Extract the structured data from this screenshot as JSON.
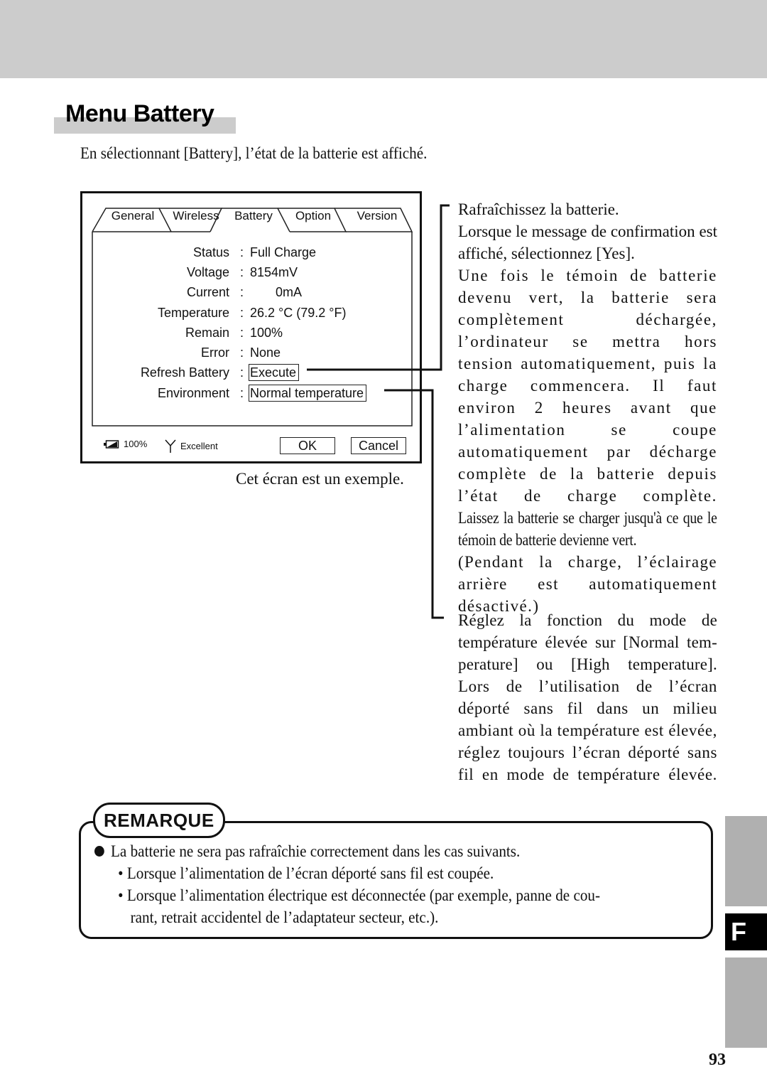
{
  "section": {
    "title": "Menu Battery",
    "intro": "En sélectionnant [Battery], l’état de la batterie est affiché."
  },
  "dialog": {
    "tabs": [
      {
        "label": "General",
        "active": false
      },
      {
        "label": "Wireless",
        "active": false
      },
      {
        "label": "Battery",
        "active": true
      },
      {
        "label": "Option",
        "active": false
      },
      {
        "label": "Version",
        "active": false
      }
    ],
    "rows": [
      {
        "label": "Status",
        "value": "Full Charge"
      },
      {
        "label": "Voltage",
        "value": "8154mV"
      },
      {
        "label": "Current",
        "value": "0mA"
      },
      {
        "label": "Temperature",
        "value": "26.2 °C (79.2 °F)"
      },
      {
        "label": "Remain",
        "value": "100%"
      },
      {
        "label": "Error",
        "value": "None"
      },
      {
        "label": "Refresh Battery",
        "value": "Execute"
      },
      {
        "label": "Environment",
        "value": "Normal temperature"
      }
    ],
    "separator": ":",
    "status_bar": {
      "battery_icon": "battery-icon",
      "battery_level": "100%",
      "signal_icon": "antenna-icon",
      "signal_quality": "Excellent"
    },
    "buttons": {
      "ok": "OK",
      "cancel": "Cancel"
    }
  },
  "caption": "Cet écran est un exemple.",
  "refresh_description": {
    "lines": [
      "Rafraîchissez la batterie.",
      "Lorsque le message de confirmation est affiché, sélectionnez [Yes].",
      "Une fois le témoin de batterie devenu vert, la batterie sera complètement déchargée, l’ordinateur se mettra hors tension automatiquement, puis la charge commencera. Il faut environ 2 heures avant que l’alimentation se coupe automatiquement par décharge complète de la batterie depuis l’état de charge complète.",
      "Laissez la batterie se charger jusqu'à ce que le témoin de batterie devienne vert.",
      "(Pendant la charge, l’éclairage arrière est automatiquement désactivé.)"
    ]
  },
  "environment_description": {
    "lines": [
      "Réglez la fonction du mode de température élevée sur [Normal tem-perature] ou [High temperature].",
      "Lors de l’utilisation de l’écran déporté sans fil dans un milieu ambiant où la température est élevée, réglez toujours l’écran déporté sans fil en mode de température élevée."
    ]
  },
  "remarque": {
    "title": "REMARQUE",
    "main": "La batterie ne sera pas rafraîchie correctement dans les cas suivants.",
    "items": [
      "Lorsque l’alimentation de l’écran déporté sans fil est coupée.",
      "Lorsque l’alimentation électrique est déconnectée (par exemple, panne de cou-",
      "rant, retrait accidentel de l’adaptateur secteur, etc.)."
    ]
  },
  "side_index": {
    "letter": "F"
  },
  "page_number": "93",
  "colors": {
    "header_band": "#cccccc",
    "side_tab": "#b0b0b0",
    "text": "#111111"
  }
}
